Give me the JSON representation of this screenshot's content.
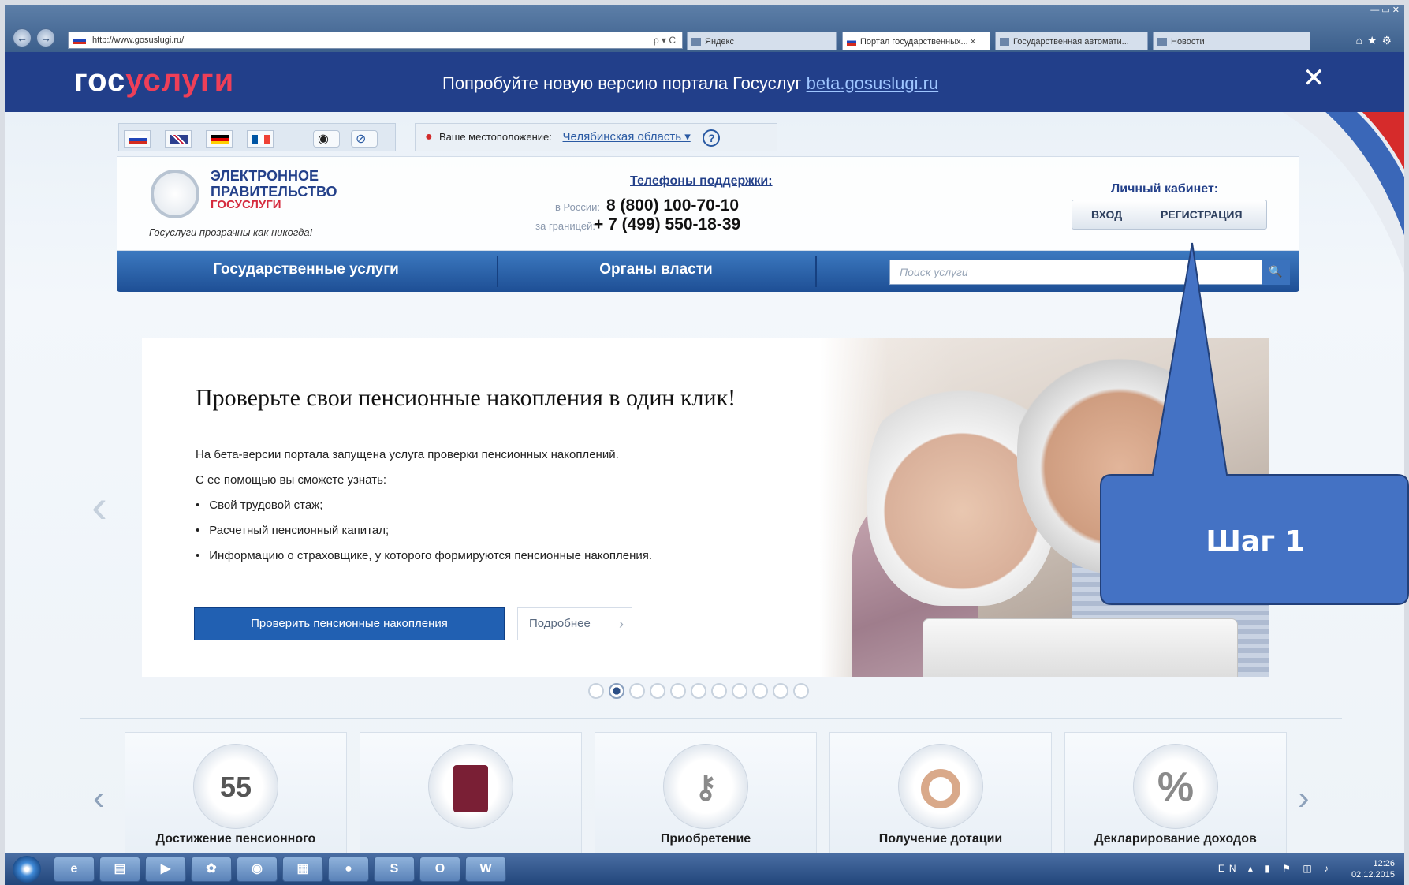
{
  "browser": {
    "address": "http://www.gosuslugi.ru/",
    "address_controls": "ρ ▾ C",
    "tabs": [
      {
        "label": "Яндекс"
      },
      {
        "label": "Портал государственных... ×"
      },
      {
        "label": "Государственная автомати..."
      },
      {
        "label": "Новости"
      }
    ]
  },
  "top_banner": {
    "logo_part1": "гос",
    "logo_part2": "услуги",
    "text": "Попробуйте новую версию портала Госуслуг ",
    "link": "beta.gosuslugi.ru",
    "close_label": "✕"
  },
  "location": {
    "label": "Ваше местоположение:",
    "region": "Челябинская область ▾",
    "help": "?"
  },
  "header": {
    "org_line1": "ЭЛЕКТРОННОЕ",
    "org_line2": "ПРАВИТЕЛЬСТВО",
    "org_line3": "ГОСУСЛУГИ",
    "slogan": "Госуслуги прозрачны как никогда!",
    "phones_title": "Телефоны поддержки:",
    "phone_ru_label": "в России:",
    "phone_ru": "8 (800) 100-70-10",
    "phone_abroad_label": "за границей:",
    "phone_abroad": "+ 7 (499) 550-18-39",
    "cabinet_title": "Личный кабинет:",
    "login": "ВХОД",
    "register": "РЕГИСТРАЦИЯ"
  },
  "nav": {
    "item1": "Государственные услуги",
    "item2": "Органы власти",
    "search_placeholder": "Поиск услуги",
    "search_icon": "🔍"
  },
  "slide": {
    "title": "Проверьте свои пенсионные накопления в один клик!",
    "p1": "На бета-версии портала запущена услуга проверки пенсионных накоплений.",
    "p2": "С ее помощью вы сможете узнать:",
    "bullets": [
      "Свой трудовой стаж;",
      "Расчетный пенсионный капитал;",
      "Информацию о страховщике, у которого формируются пенсионные накопления."
    ],
    "check_button": "Проверить пенсионные накопления",
    "more_button": "Подробнее",
    "prev": "‹",
    "dots_total": 11,
    "dots_active": 2
  },
  "categories": [
    {
      "icon": "55",
      "label": "Достижение пенсионного"
    },
    {
      "icon": "",
      "label": ""
    },
    {
      "icon": "",
      "label": "Приобретение"
    },
    {
      "icon": "",
      "label": "Получение дотации"
    },
    {
      "icon": "%",
      "label": "Декларирование доходов"
    }
  ],
  "callout": {
    "text": "Шаг 1",
    "color": "#4472c4"
  },
  "taskbar": {
    "apps": [
      "e",
      "▤",
      "▶",
      "✿",
      "◉",
      "▦",
      "●",
      "S",
      "O",
      "W"
    ],
    "lang": "EN",
    "time": "12:26",
    "date": "02.12.2015"
  }
}
